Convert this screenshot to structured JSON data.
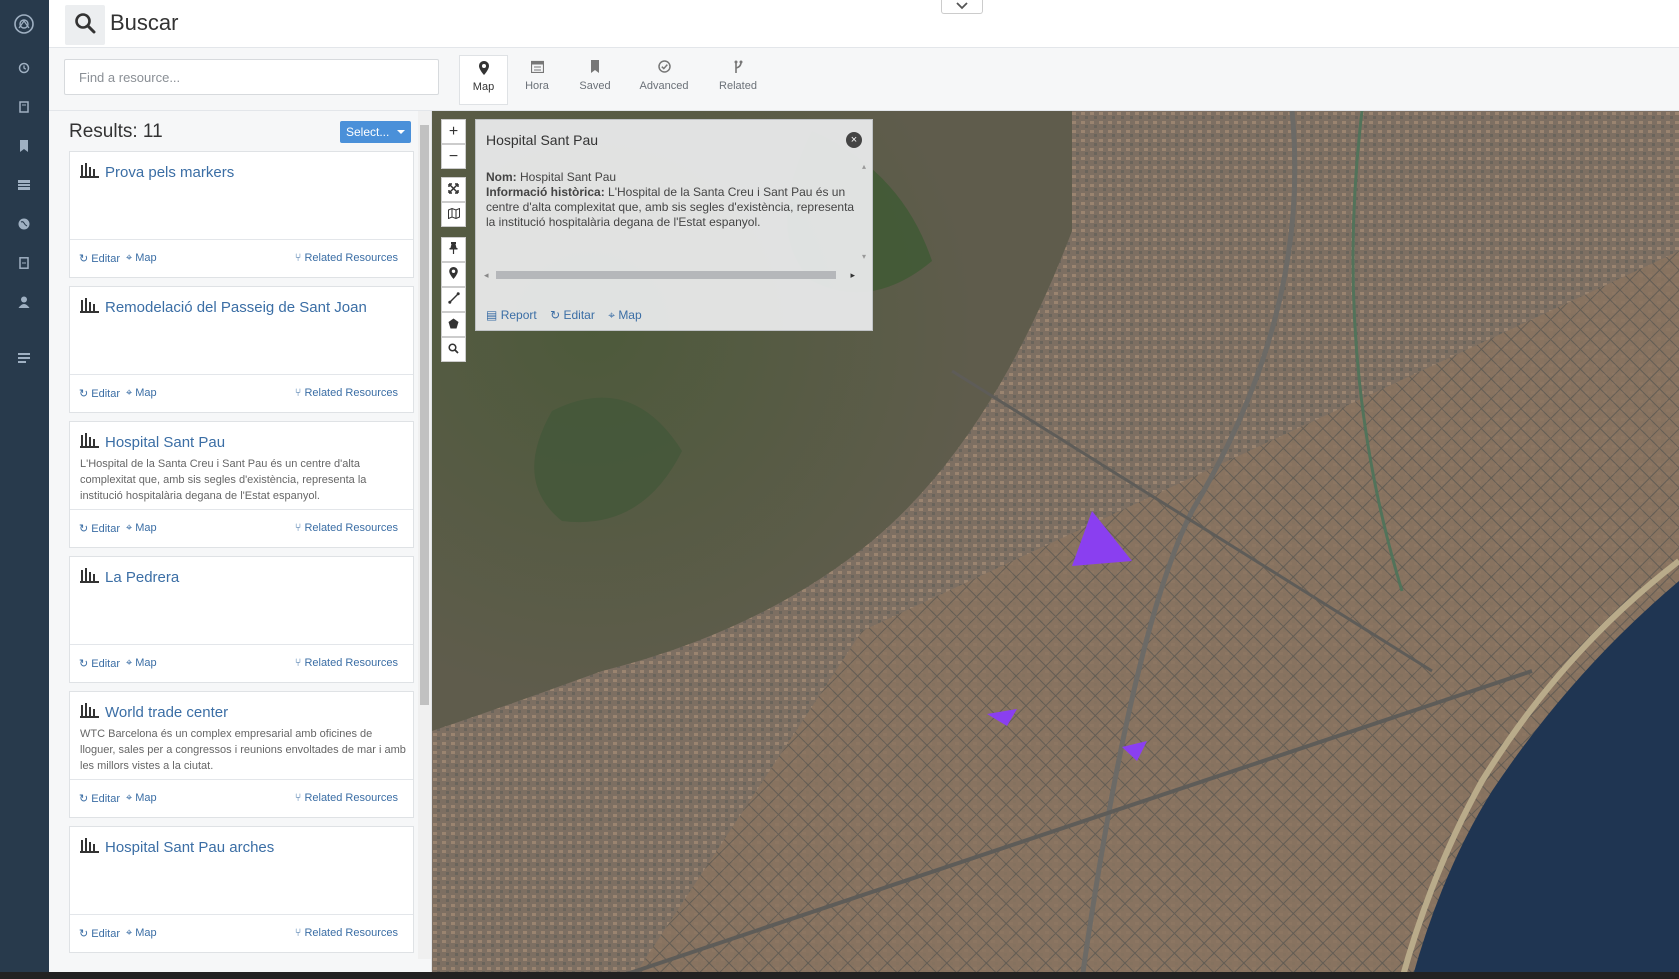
{
  "header": {
    "title": "Buscar",
    "search_icon": "search-icon",
    "collapse_icon": "chevron-down-icon"
  },
  "rail": {
    "items": [
      "logo-icon",
      "history-icon",
      "book-icon",
      "bookmark-icon",
      "table-icon",
      "globe-icon",
      "file-icon",
      "user-icon",
      "menu-icon"
    ]
  },
  "filter": {
    "placeholder": "Find a resource...",
    "tabs": [
      {
        "label": "Map",
        "icon": "map-marker-icon",
        "active": true
      },
      {
        "label": "Hora",
        "icon": "calendar-icon"
      },
      {
        "label": "Saved",
        "icon": "bookmark-icon"
      },
      {
        "label": "Advanced",
        "icon": "check-circle-icon"
      },
      {
        "label": "Related",
        "icon": "fork-icon"
      }
    ]
  },
  "results": {
    "count_label": "Results: 11",
    "select_label": "Select...",
    "edit_label": "Editar",
    "map_label": "Map",
    "related_label": "Related Resources",
    "items": [
      {
        "title": "Prova pels markers",
        "desc": ""
      },
      {
        "title": "Remodelació del Passeig de Sant Joan",
        "desc": ""
      },
      {
        "title": "Hospital Sant Pau",
        "desc": "L'Hospital de la Santa Creu i Sant Pau és un centre d'alta complexitat que, amb sis segles d'existència, representa la institució hospitalària degana de l'Estat espanyol."
      },
      {
        "title": "La Pedrera",
        "desc": ""
      },
      {
        "title": "World trade center",
        "desc": "WTC Barcelona és un complex empresarial amb oficines de lloguer, sales per a congressos i reunions envoltades de mar i amb les millors vistes a la ciutat."
      },
      {
        "title": "Hospital Sant Pau arches",
        "desc": ""
      }
    ]
  },
  "popup": {
    "title": "Hospital Sant Pau",
    "nom_label": "Nom:",
    "nom_value": "Hospital Sant Pau",
    "info_label": "Informació històrica:",
    "info_value": "L'Hospital de la Santa Creu i Sant Pau és un centre d'alta complexitat que, amb sis segles d'existència, representa la institució hospitalària degana de l'Estat espanyol.",
    "report_label": "Report",
    "edit_label": "Editar",
    "map_label": "Map"
  },
  "map": {
    "controls": [
      "zoom-in",
      "zoom-out",
      "fullscreen",
      "basemap",
      "pin",
      "marker",
      "line",
      "polygon",
      "search"
    ],
    "marker_color": "#8a3ff0"
  }
}
